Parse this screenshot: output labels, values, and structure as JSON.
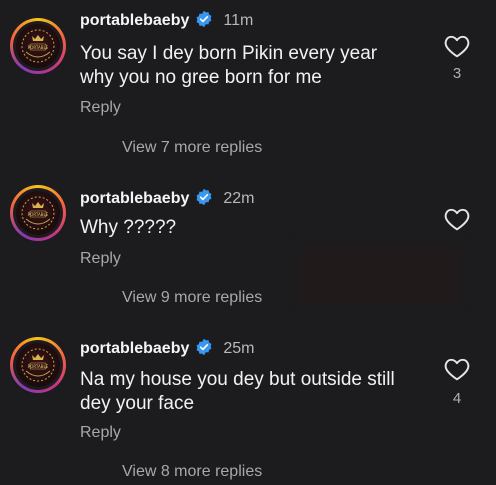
{
  "comments": [
    {
      "username": "portablebaeby",
      "time": "11m",
      "text": "You say I dey born Pikin  every year why you no gree born for me",
      "reply_label": "Reply",
      "view_more": "View 7 more replies",
      "likes": "3"
    },
    {
      "username": "portablebaeby",
      "time": "22m",
      "text": "Why ?????",
      "reply_label": "Reply",
      "view_more": "View 9 more replies",
      "likes": ""
    },
    {
      "username": "portablebaeby",
      "time": "25m",
      "text": "Na my house you dey but outside still dey your face",
      "reply_label": "Reply",
      "view_more": "View 8 more replies",
      "likes": "4"
    }
  ],
  "colors": {
    "background": "#1c1c1e",
    "verified_blue": "#3897f0",
    "secondary_text": "#a8a8a8"
  },
  "icons": {
    "like": "heart-outline-icon",
    "verified": "verified-badge-icon"
  }
}
